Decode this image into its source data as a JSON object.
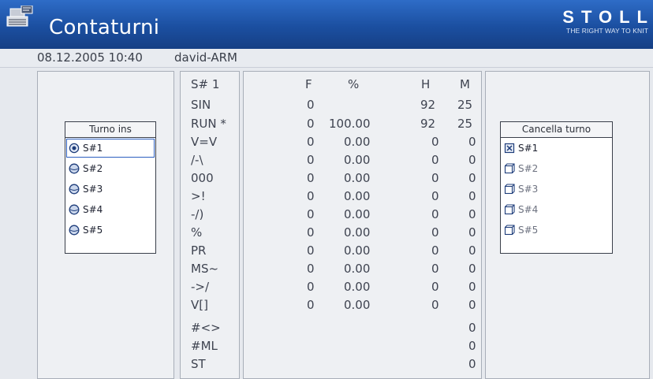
{
  "header": {
    "title": "Contaturni",
    "brand": "STOLL",
    "brand_slogan": "THE RIGHT WAY TO KNIT",
    "icon": "knitting-machine-icon"
  },
  "status": {
    "timestamp": "08.12.2005 10:40",
    "user": "david-ARM"
  },
  "turno_ins": {
    "title": "Turno ins",
    "items": [
      {
        "label": "S#1",
        "selected": true
      },
      {
        "label": "S#2",
        "selected": false
      },
      {
        "label": "S#3",
        "selected": false
      },
      {
        "label": "S#4",
        "selected": false
      },
      {
        "label": "S#5",
        "selected": false
      }
    ]
  },
  "cancella_turno": {
    "title": "Cancella turno",
    "items": [
      {
        "label": "S#1",
        "checked": true
      },
      {
        "label": "S#2",
        "checked": false
      },
      {
        "label": "S#3",
        "checked": false
      },
      {
        "label": "S#4",
        "checked": false
      },
      {
        "label": "S#5",
        "checked": false
      }
    ]
  },
  "table": {
    "shift_label": "S# 1",
    "columns": [
      "F",
      "%",
      "H",
      "M"
    ],
    "rows": [
      {
        "label": "SIN",
        "F": "0",
        "pct": "",
        "H": "92",
        "M": "25"
      },
      {
        "label": "RUN *",
        "F": "0",
        "pct": "100.00",
        "H": "92",
        "M": "25"
      },
      {
        "label": "V=V",
        "F": "0",
        "pct": "0.00",
        "H": "0",
        "M": "0"
      },
      {
        "label": "/-\\",
        "F": "0",
        "pct": "0.00",
        "H": "0",
        "M": "0"
      },
      {
        "label": "000",
        "F": "0",
        "pct": "0.00",
        "H": "0",
        "M": "0"
      },
      {
        "label": ">!",
        "F": "0",
        "pct": "0.00",
        "H": "0",
        "M": "0"
      },
      {
        "label": "-/)",
        "F": "0",
        "pct": "0.00",
        "H": "0",
        "M": "0"
      },
      {
        "label": "%",
        "F": "0",
        "pct": "0.00",
        "H": "0",
        "M": "0"
      },
      {
        "label": "PR",
        "F": "0",
        "pct": "0.00",
        "H": "0",
        "M": "0"
      },
      {
        "label": "MS~",
        "F": "0",
        "pct": "0.00",
        "H": "0",
        "M": "0"
      },
      {
        "label": "->/",
        "F": "0",
        "pct": "0.00",
        "H": "0",
        "M": "0"
      },
      {
        "label": "V[]",
        "F": "0",
        "pct": "0.00",
        "H": "0",
        "M": "0"
      }
    ],
    "extra_rows": [
      {
        "label": "#<>",
        "M": "0"
      },
      {
        "label": "#ML",
        "M": "0"
      },
      {
        "label": "ST",
        "M": "0"
      }
    ]
  }
}
